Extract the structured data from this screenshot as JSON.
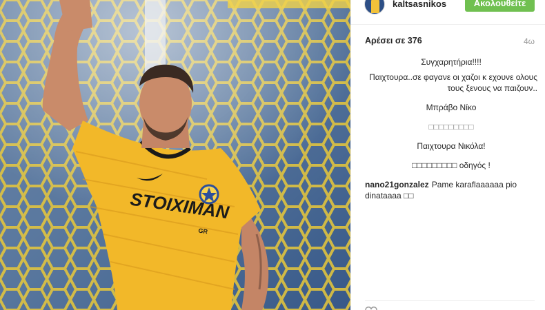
{
  "header": {
    "username": "kaltsasnikos",
    "follow_label": "Ακολουθείτε"
  },
  "post": {
    "likes": "Αρέσει σε 376",
    "time": "4ω"
  },
  "comments": [
    {
      "author": "",
      "text": "Συγχαρητήρια!!!!",
      "align": "center"
    },
    {
      "author": "",
      "text": "Παιχτουρα..σε φαγανε οι χαζοι κ εχουνε ολους τους ξενους να παιζουν..",
      "align": "left"
    },
    {
      "author": "",
      "text": "Μπράβο Νίκο",
      "align": "center"
    },
    {
      "author": "",
      "text": "□□□□□□□□□",
      "align": "center"
    },
    {
      "author": "",
      "text": "Παιχτουρα Νικόλα!",
      "align": "center"
    },
    {
      "author": "",
      "text": "□□□□□□□□□ οδηγός !",
      "align": "center"
    },
    {
      "author": "nano21gonzalez",
      "text": "Pame karaflaaaaaa pio dinataaaa □□",
      "align": "left"
    }
  ],
  "photo": {
    "jersey_sponsor": "STOIXIMAN",
    "jersey_sponsor_suffix": "GR"
  },
  "colors": {
    "follow_green": "#70c050",
    "jersey_yellow": "#f2b829",
    "net_blue": "#3f6fb8"
  }
}
